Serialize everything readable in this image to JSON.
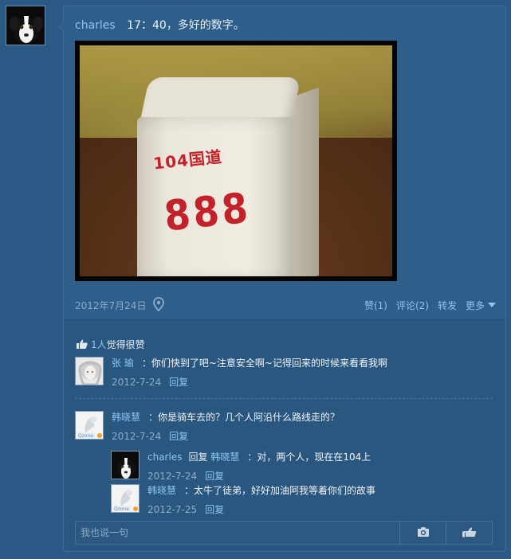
{
  "post": {
    "author": "charles",
    "time": "17：40，",
    "text": "多好的数字。",
    "photo": {
      "label_text": "104国道",
      "number_text": "888"
    },
    "date": "2012年7月24日",
    "actions": [
      {
        "label": "赞(1)"
      },
      {
        "label": "评论(2)"
      },
      {
        "label": "转发"
      },
      {
        "label": "更多"
      }
    ]
  },
  "likes": {
    "count": "1人",
    "text": "觉得很赞"
  },
  "comments": [
    {
      "name": "张 瑜",
      "text": "：你们快到了吧~注意安全啊~记得回来的时候来看看我啊",
      "date": "2012-7-24",
      "reply_label": "回复"
    },
    {
      "name": "韩晓慧",
      "text": "：你是骑车去的？几个人阿沿什么路线走的？",
      "date": "2012-7-24",
      "reply_label": "回复",
      "replies": [
        {
          "name": "charles",
          "reply_word": "回复",
          "to": "韩晓慧",
          "text": "：对，两个人，现在在104上",
          "date": "2012-7-24",
          "reply_label": "回复"
        },
        {
          "name": "韩晓慧",
          "text": "：太牛了徒弟，好好加油阿我等着你们的故事",
          "date": "2012-7-25",
          "reply_label": "回复"
        }
      ]
    }
  ],
  "composer": {
    "placeholder": "我也说一句"
  },
  "colors": {
    "bg": "#2a5a85",
    "link": "#8ac6f2",
    "marker_red": "#c2232b"
  },
  "icons": [
    "location-pin-icon",
    "thumbs-up-icon",
    "camera-icon",
    "pointing-hand-icon",
    "chevron-down-icon"
  ]
}
